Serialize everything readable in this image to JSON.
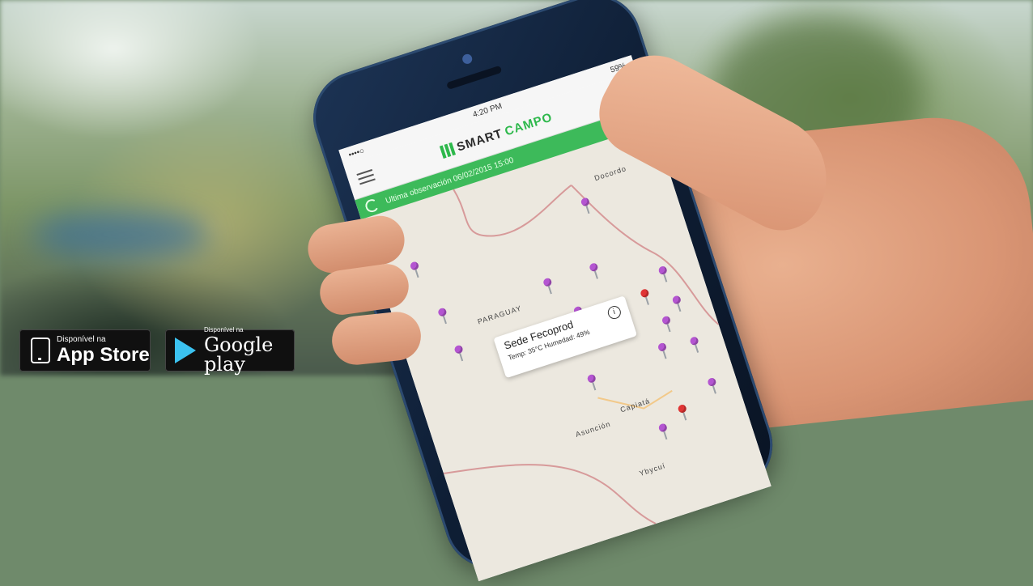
{
  "status_bar": {
    "carrier": "••••○",
    "time": "4:20 PM",
    "battery": "59%"
  },
  "app": {
    "logo_part1": "SMART",
    "logo_part2": "CAMPO",
    "brand_color": "#3dba5a",
    "last_observation": "Ultima observación 06/02/2015 15:00"
  },
  "map": {
    "labels": {
      "country": "PARAGUAY",
      "city1": "Asunción",
      "city2": "Capiatá",
      "city3": "Ybycuí",
      "city4": "Docordo"
    },
    "popup": {
      "title": "Sede Fecoprod",
      "details": "Temp: 35°C  Humedad: 49%",
      "info_icon": "i"
    }
  },
  "badges": {
    "appstore_small": "Disponível na",
    "appstore_big": "App Store",
    "google_small": "Disponível na",
    "google_big": "Google play"
  },
  "icons": [
    "menu-icon",
    "search-icon",
    "refresh-icon",
    "info-icon",
    "apple-icon",
    "google-play-icon",
    "map-pin-icon"
  ]
}
